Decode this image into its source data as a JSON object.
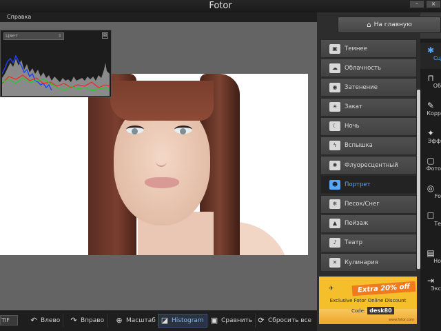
{
  "window": {
    "title": "Fotor",
    "buttons": [
      "–",
      "×"
    ]
  },
  "menu": {
    "items": [
      "Справка"
    ]
  },
  "histogram": {
    "channel_select": "Цвет",
    "close_glyph": "⊠"
  },
  "bottom_toolbar": {
    "format": "TIF",
    "buttons": [
      {
        "label": "Влево",
        "icon": "rotate-left-icon",
        "glyph": "↶"
      },
      {
        "label": "Вправо",
        "icon": "rotate-right-icon",
        "glyph": "↷"
      },
      {
        "label": "Масштаб",
        "icon": "zoom-icon",
        "glyph": "⊕"
      },
      {
        "label": "Histogram",
        "icon": "histogram-icon",
        "glyph": "◪",
        "active": true
      },
      {
        "label": "Сравнить",
        "icon": "compare-icon",
        "glyph": "▣"
      },
      {
        "label": "Сбросить все",
        "icon": "reset-icon",
        "glyph": "⟳"
      }
    ]
  },
  "home_button": {
    "label": "На главную",
    "glyph": "⌂"
  },
  "scenes": {
    "items": [
      {
        "label": "Темнее",
        "glyph": "▣"
      },
      {
        "label": "Облачность",
        "glyph": "☁"
      },
      {
        "label": "Затенение",
        "glyph": "◉"
      },
      {
        "label": "Закат",
        "glyph": "☀"
      },
      {
        "label": "Ночь",
        "glyph": "☾"
      },
      {
        "label": "Вспышка",
        "glyph": "ϟ"
      },
      {
        "label": "Флуоресцентный",
        "glyph": "✺"
      },
      {
        "label": "Портрет",
        "glyph": "☻",
        "selected": true
      },
      {
        "label": "Песок/Снег",
        "glyph": "❄"
      },
      {
        "label": "Пейзаж",
        "glyph": "▲"
      },
      {
        "label": "Театр",
        "glyph": "♪"
      },
      {
        "label": "Кулинария",
        "glyph": "✕"
      }
    ]
  },
  "ad": {
    "headline": "Extra 20% off",
    "subline": "Exclusive Fotor Online Discount",
    "code_label": "Code:",
    "code": "desk80",
    "url": "www.fotor.com"
  },
  "side_nav": {
    "items": [
      {
        "label": "Сц",
        "glyph": "✱",
        "active": true
      },
      {
        "label": "Об",
        "glyph": "⊓"
      },
      {
        "label": "Корр",
        "glyph": "✎"
      },
      {
        "label": "Эфф",
        "glyph": "✦"
      },
      {
        "label": "Фото",
        "glyph": "▢"
      },
      {
        "label": "Fo",
        "glyph": "◎"
      },
      {
        "label": "Те",
        "glyph": "☐"
      },
      {
        "label": "Но",
        "glyph": "▤"
      },
      {
        "label": "Экс",
        "glyph": "⇥"
      }
    ]
  },
  "colors": {
    "accent": "#57a9ff",
    "ad_yellow": "#f4bf2b",
    "ad_orange": "#ef7a1f"
  }
}
